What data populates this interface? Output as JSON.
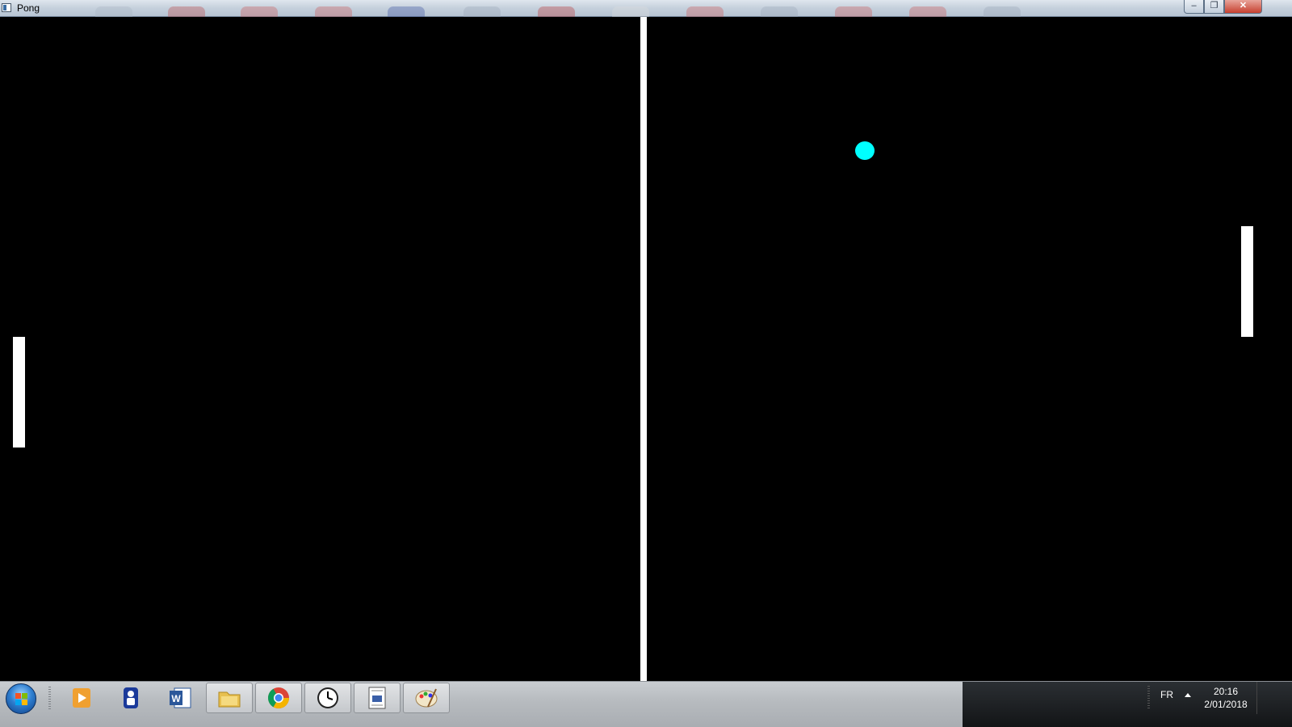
{
  "window": {
    "title": "Pong",
    "minimize_label": "–",
    "maximize_label": "❐",
    "close_label": "✕"
  },
  "game": {
    "net_color": "#ffffff",
    "paddle_color": "#ffffff",
    "ball_color": "#00ffff",
    "background": "#000000"
  },
  "taskbar": {
    "pinned": [
      {
        "name": "media-player",
        "icon": "media-player-icon"
      },
      {
        "name": "contacts",
        "icon": "user-icon"
      },
      {
        "name": "word",
        "icon": "word-icon"
      },
      {
        "name": "explorer",
        "icon": "folder-icon"
      },
      {
        "name": "chrome",
        "icon": "chrome-icon"
      },
      {
        "name": "clock",
        "icon": "clock-icon"
      },
      {
        "name": "java-app",
        "icon": "document-icon"
      },
      {
        "name": "paint",
        "icon": "paint-icon"
      }
    ],
    "language": "FR",
    "time": "20:16",
    "date": "2/01/2018"
  }
}
